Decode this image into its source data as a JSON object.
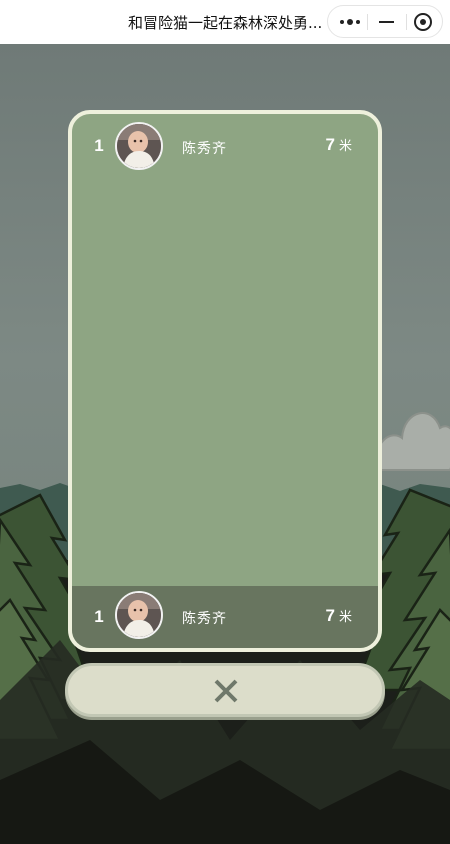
{
  "topbar": {
    "title": "和冒险猫一起在森林深处勇...",
    "more_icon": "more-dots-icon",
    "minimize_icon": "minimize-icon",
    "close_icon": "target-close-icon"
  },
  "leaderboard": {
    "entries": [
      {
        "rank": "1",
        "name": "陈秀齐",
        "distance": "7",
        "unit": "米"
      }
    ],
    "my_entry": {
      "rank": "1",
      "name": "陈秀齐",
      "distance": "7",
      "unit": "米"
    }
  },
  "close_button": {
    "icon": "close-x-icon"
  },
  "colors": {
    "card_bg": "#8ea583",
    "card_border": "#eef0dc",
    "my_row_bg": "#68755f",
    "button_bg": "#dcddca"
  }
}
